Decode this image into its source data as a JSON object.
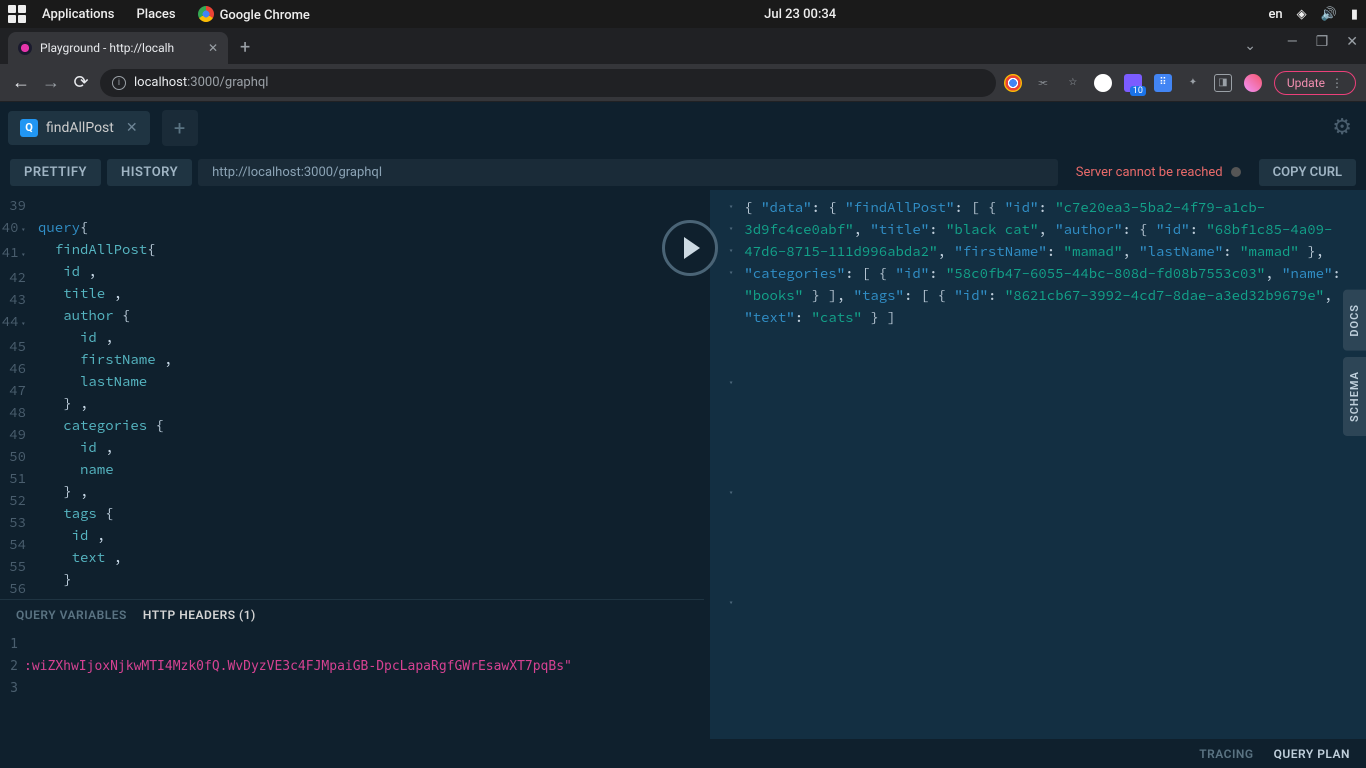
{
  "desktop": {
    "applications": "Applications",
    "places": "Places",
    "chrome": "Google Chrome",
    "datetime": "Jul 23  00:34",
    "lang": "en"
  },
  "browser": {
    "tab_title": "Playground - http://localh",
    "url_host": "localhost",
    "url_path": ":3000/graphql",
    "update": "Update",
    "ext_badge": "10"
  },
  "playground": {
    "tab_name": "findAllPost",
    "tab_badge": "Q",
    "prettify": "PRETTIFY",
    "history": "HISTORY",
    "endpoint": "http://localhost:3000/graphql",
    "status": "Server cannot be reached",
    "copy_curl": "COPY CURL",
    "side_docs": "DOCS",
    "side_schema": "SCHEMA",
    "vars_tab": "QUERY VARIABLES",
    "headers_tab": "HTTP HEADERS (1)",
    "footer_tracing": "TRACING",
    "footer_queryplan": "QUERY PLAN"
  },
  "query": {
    "line_start": 39,
    "kw": "query",
    "root": "findAllPost",
    "fields": {
      "id": "id",
      "title": "title",
      "author": "author",
      "firstName": "firstName",
      "lastName": "lastName",
      "categories": "categories",
      "name": "name",
      "tags": "tags",
      "text": "text"
    }
  },
  "headers_value": ":wiZXhwIjoxNjkwMTI4Mzk0fQ.WvDyzVE3c4FJMpaiGB-DpcLapaRgfGWrEsawXT7pqBs\"",
  "result": {
    "data_key": "\"data\"",
    "findAllPost_key": "\"findAllPost\"",
    "id_key": "\"id\"",
    "title_key": "\"title\"",
    "author_key": "\"author\"",
    "firstName_key": "\"firstName\"",
    "lastName_key": "\"lastName\"",
    "categories_key": "\"categories\"",
    "name_key": "\"name\"",
    "tags_key": "\"tags\"",
    "text_key": "\"text\"",
    "post_id": "\"c7e20ea3-5ba2-4f79-a1cb-3d9fc4ce0abf\"",
    "post_title": "\"black cat\"",
    "author_id": "\"68bf1c85-4a09-47d6-8715-111d996abda2\"",
    "author_first": "\"mamad\"",
    "author_last": "\"mamad\"",
    "cat_id": "\"58c0fb47-6055-44bc-808d-fd08b7553c03\"",
    "cat_name": "\"books\"",
    "tag_id": "\"8621cb67-3992-4cd7-8dae-a3ed32b9679e\"",
    "tag_text": "\"cats\""
  },
  "chart_data": null
}
